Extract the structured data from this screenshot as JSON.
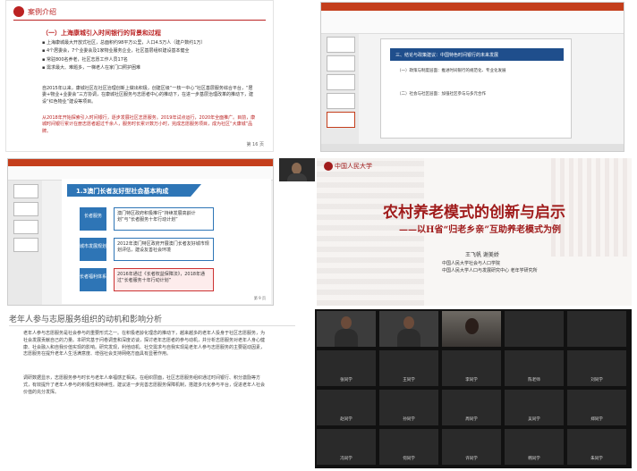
{
  "c1": {
    "title": "案例介绍",
    "section": "（一）上海康城引入时间银行的背景和过程",
    "bullets": [
      "上海康城最大开放式社区，总面积约98平方公里，人口4.5万人（建户数约1万）",
      "4个居委会，7个业委会及1家物业服务企业，社区基层组织建设基本健全",
      "常驻800名养老，社区志愿工作人员17名",
      "需求最大、难题多，一梯老人在家门口照护困难"
    ],
    "para1": "自2015年以来，康城社区在社区治理创新上做出积极，创建区级“一核一中心”社区基层服务综合平台，“居委+物业+业委会”三方协调，在康城社区服务与志愿者中心的推动下，在进一步基层治理改革的推动下，建设“红色物业”建设等项目。",
    "para2": "从2018年开始探索引入时间银行，逐步发展社区志愿服务。2019年试点运行，2020年全面推广。目前，康城时间银行累计在册志愿者超过千余人，服务时长累计数万小时，完成志愿服务项目，成为社区“大康城”品牌。",
    "page": "第 16 页"
  },
  "c2": {
    "band": "三、结论与政策建议：中国特色时间银行的未来发展",
    "rows": [
      "（一）政策与制度层面：推进时间银行的规范化、专业化发展",
      "（二）社会与社区层面：加强社区参与与多元合作"
    ]
  },
  "c3": {
    "header": "1.3澳门长者友好型社会基本构成",
    "labels": [
      "长者服务",
      "城市发展规划",
      "长者福利体系"
    ],
    "boxes": [
      "澳门特区政府积极推行“持续发展高龄计划”与“长者服务十年行动计划”",
      "2012年澳门特区政府开展澳门长者友好城市规划评估，建设友善社会环境",
      "2016年通过《长者权益保障法》，2018年通过“长者服务十年行动计划”"
    ],
    "page": "第 9 页"
  },
  "c4": {
    "brand": "中国人民大学",
    "main_title": "农村养老模式的创新与启示",
    "subtitle": "——以H省“归老乡亲”互助养老模式为例",
    "authors": "王飞帆  谢美娇",
    "affiliations": [
      "中国人民大学社会与人口学院",
      "中国人民大学人口与发展研究中心 老年学研究所"
    ]
  },
  "c5": {
    "doc_title": "老年人参与志愿服务组织的动机和影响分析",
    "paras": [
      "老年人参与志愿服务是社会参与的重要形式之一。在积极老龄化理念的推动下，越来越多的老年人投身于社区志愿服务，为社会发展贡献自己的力量。本研究基于问卷调查和深度访谈，探讨老年志愿者的参与动机，并分析志愿服务对老年人身心健康、社会融入和自我价值实现的影响。研究发现，利他动机、社交需求与自我实现是老年人参与志愿服务的主要驱动因素，志愿服务在提升老年人生活满意度、增强社会支持网络方面具有显著作用。",
      "调研数据显示，志愿服务参与时长与老年人幸福感正相关。在组织层面，社区志愿服务组织通过时间银行、积分激励等方式，有效提升了老年人参与的积极性和持续性。建议进一步完善志愿服务保障机制，搭建多元化参与平台，促进老年人社会价值的充分发挥。"
    ]
  },
  "c6": {
    "participants": [
      "张同学",
      "王同学",
      "李同学",
      "陈老师",
      "刘同学",
      "赵同学",
      "孙同学",
      "周同学",
      "吴同学",
      "郑同学",
      "冯同学",
      "何同学",
      "许同学",
      "韩同学",
      "朱同学"
    ]
  }
}
